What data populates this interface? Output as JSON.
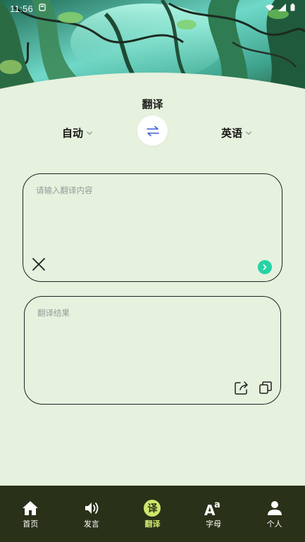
{
  "status_bar": {
    "time": "11:56"
  },
  "page": {
    "title": "翻译"
  },
  "languages": {
    "source": "自动",
    "target": "英语"
  },
  "input": {
    "placeholder": "请输入翻译内容",
    "value": ""
  },
  "result": {
    "placeholder": "翻译结果"
  },
  "bottom_nav": {
    "items": [
      {
        "label": "首页",
        "icon": "home-icon"
      },
      {
        "label": "发言",
        "icon": "speaker-icon"
      },
      {
        "label": "翻译",
        "icon": "translate-icon",
        "badge": "译",
        "active": true
      },
      {
        "label": "字母",
        "icon": "letters-icon"
      },
      {
        "label": "个人",
        "icon": "person-icon"
      }
    ]
  },
  "colors": {
    "background": "#e6f1de",
    "nav_background": "#293118",
    "nav_active": "#cde66a",
    "accent_swap": "#3a5bd9",
    "accent_go": "#26d3a4"
  }
}
